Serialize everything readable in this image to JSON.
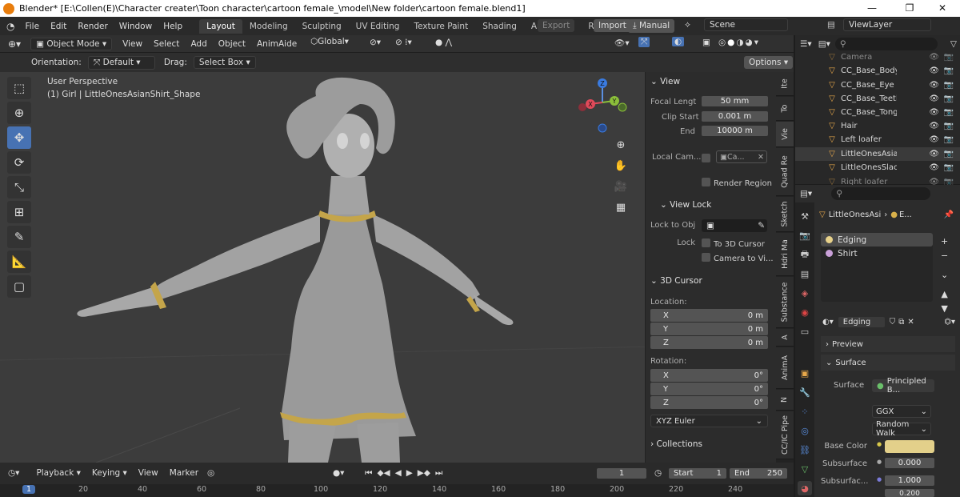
{
  "titlebar": {
    "title": "Blender* [E:\\Collen(E)\\Character creater\\Toon character\\cartoon female_\\model\\New folder\\cartoon female.blend1]",
    "minimize": "—",
    "maximize": "❐",
    "close": "✕"
  },
  "menu": [
    "File",
    "Edit",
    "Render",
    "Window",
    "Help"
  ],
  "workspaces": [
    "Layout",
    "Modeling",
    "Sculpting",
    "UV Editing",
    "Texture Paint",
    "Shading",
    "Animation",
    "Re"
  ],
  "topbar": {
    "export": "Export",
    "import": "Import",
    "manual": "Manual",
    "scene": "Scene",
    "viewlayer": "ViewLayer"
  },
  "viewport_header": {
    "mode": "Object Mode",
    "menus": [
      "View",
      "Select",
      "Add",
      "Object",
      "AnimAide"
    ],
    "transform": "Global",
    "options": "Options"
  },
  "viewport_header2": {
    "orientation_label": "Orientation:",
    "orientation": "Default",
    "drag_label": "Drag:",
    "drag": "Select Box"
  },
  "viewport": {
    "perspective": "User Perspective",
    "object_info": "(1) Girl | LittleOnesAsianShirt_Shape"
  },
  "gizmo": {
    "x": "X",
    "y": "Y",
    "z": "Z"
  },
  "npanel": {
    "view_header": "View",
    "focal_label": "Focal Lengt",
    "focal": "50 mm",
    "clip_start_label": "Clip Start",
    "clip_start": "0.001 m",
    "end_label": "End",
    "end": "10000 m",
    "local_cam_label": "Local Cam...",
    "local_cam_value": "Ca...",
    "render_region": "Render Region",
    "view_lock_header": "View Lock",
    "lock_to_obj_label": "Lock to Obj",
    "lock_label": "Lock",
    "to_3d_cursor": "To 3D Cursor",
    "camera_to_view": "Camera to Vi...",
    "cursor_header": "3D Cursor",
    "location_label": "Location:",
    "loc": [
      {
        "axis": "X",
        "val": "0 m"
      },
      {
        "axis": "Y",
        "val": "0 m"
      },
      {
        "axis": "Z",
        "val": "0 m"
      }
    ],
    "rotation_label": "Rotation:",
    "rot": [
      {
        "axis": "X",
        "val": "0°"
      },
      {
        "axis": "Y",
        "val": "0°"
      },
      {
        "axis": "Z",
        "val": "0°"
      }
    ],
    "rotation_mode": "XYZ Euler",
    "collections_header": "Collections"
  },
  "side_tabs": [
    "Ite",
    "To",
    "Vie",
    "Quad Re",
    "Sketch",
    "Hdri Ma",
    "Substance",
    "A",
    "AnimA",
    "N",
    "CC/IC Pipe"
  ],
  "outliner": {
    "items": [
      {
        "name": "Camera",
        "dim": true
      },
      {
        "name": "CC_Base_Body"
      },
      {
        "name": "CC_Base_Eye"
      },
      {
        "name": "CC_Base_Teeth"
      },
      {
        "name": "CC_Base_Tongue"
      },
      {
        "name": "Hair"
      },
      {
        "name": "Left loafer"
      },
      {
        "name": "LittleOnesAsianShirt",
        "selected": true
      },
      {
        "name": "LittleOnesSlacks"
      },
      {
        "name": "Right loafer",
        "dim": true
      }
    ]
  },
  "properties": {
    "breadcrumb_obj": "LittleOnesAsi",
    "breadcrumb_mat": "E...",
    "materials": [
      {
        "name": "Edging",
        "color": "#e8d28a"
      },
      {
        "name": "Shirt",
        "color": "#c9a0d8"
      }
    ],
    "material_name": "Edging",
    "preview": "Preview",
    "surface_header": "Surface",
    "surface_label": "Surface",
    "surface_value": "Principled B...",
    "distribution": "GGX",
    "subsurface_method": "Random Walk",
    "base_color_label": "Base Color",
    "base_color": "#e3d08a",
    "subsurface_label": "Subsurface",
    "subsurface_value": "0.000",
    "subsurface_radius_label": "Subsurfac...",
    "subsurface_radius_1": "1.000",
    "subsurface_radius_2": "0.200"
  },
  "timeline": {
    "playback": "Playback",
    "keying": "Keying",
    "view": "View",
    "marker": "Marker",
    "current_frame": "1",
    "start_label": "Start",
    "start": "1",
    "end_label": "End",
    "end": "250",
    "ruler": [
      "1",
      "20",
      "40",
      "60",
      "80",
      "100",
      "120",
      "140",
      "160",
      "180",
      "200",
      "220",
      "240"
    ]
  }
}
